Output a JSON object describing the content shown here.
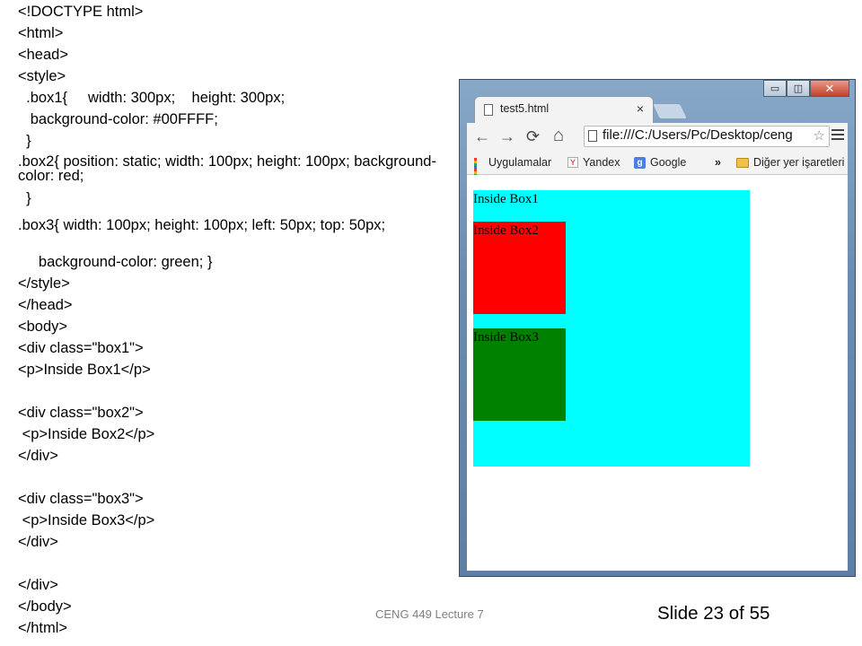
{
  "code_lines": [
    "<!DOCTYPE html>",
    "<html>",
    "<head>",
    "<style>",
    "  .box1{     width: 300px;    height: 300px;",
    "   background-color: #00FFFF;",
    "  }",
    "  .box2{     position: static;   width: 100px;   height: 100px; background-color: red;",
    "  }",
    "  .box3{    width: 100px;     height: 100px;  left: 50px;    top: 50px;",
    "     background-color: green; }",
    "</style>",
    "</head>",
    "<body>",
    "<div class=\"box1\">",
    "<p>Inside Box1</p>",
    "",
    "<div class=\"box2\">",
    " <p>Inside Box2</p>",
    "</div>",
    "",
    "<div class=\"box3\">",
    " <p>Inside Box3</p>",
    "</div>",
    "",
    "</div>",
    "</body>",
    "</html>"
  ],
  "browser": {
    "tab_title": "test5.html",
    "tab_close": "×",
    "window_buttons": {
      "minimize": "▭",
      "maximize": "◫",
      "close": "✕"
    },
    "nav": {
      "back": "←",
      "forward": "→",
      "reload": "⟳",
      "home": "⌂"
    },
    "address": "file:///C:/Users/Pc/Desktop/ceng",
    "bookmarks": [
      "Uygulamalar",
      "Yandex",
      "Google",
      "»",
      "Diğer yer işaretleri"
    ],
    "page": {
      "box1_text": "Inside Box1",
      "box2_text": "Inside Box2",
      "box3_text": "Inside Box3"
    },
    "colors": {
      "box1": "#00FFFF",
      "box2": "#FF0000",
      "box3": "#008000"
    }
  },
  "footer": {
    "lecture": "CENG 449 Lecture 7",
    "slide": "Slide 23 of 55"
  }
}
